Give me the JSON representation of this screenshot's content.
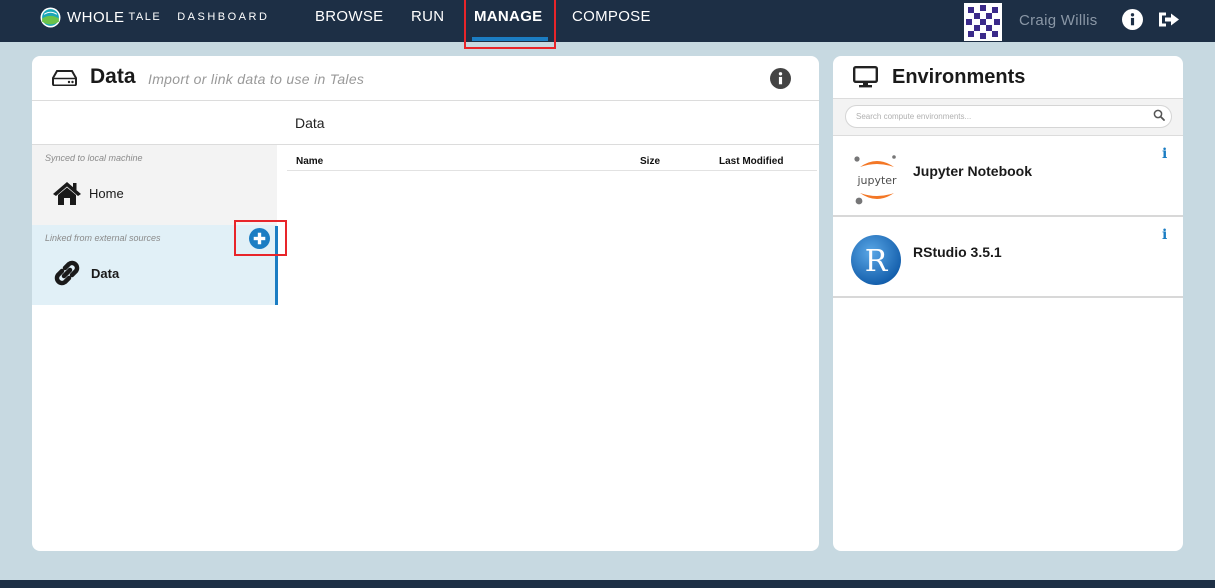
{
  "brand": {
    "name_main": "WHOLE",
    "name_sub": "TALE",
    "section": "DASHBOARD"
  },
  "nav": {
    "browse": "BROWSE",
    "run": "RUN",
    "manage": "MANAGE",
    "compose": "COMPOSE",
    "active": "MANAGE"
  },
  "user": {
    "name": "Craig Willis"
  },
  "data_panel": {
    "title": "Data",
    "subtitle": "Import or link data to use in Tales",
    "breadcrumb": "Data",
    "sidebar": {
      "synced_caption": "Synced to local machine",
      "home_label": "Home",
      "linked_caption": "Linked from external sources",
      "data_label": "Data"
    },
    "table": {
      "columns": [
        "Name",
        "Size",
        "Last Modified"
      ],
      "rows": []
    }
  },
  "env_panel": {
    "title": "Environments",
    "search_placeholder": "Search compute environments...",
    "items": [
      {
        "name": "Jupyter Notebook",
        "logo": "jupyter-logo",
        "info": "i"
      },
      {
        "name": "RStudio 3.5.1",
        "logo": "rstudio-logo",
        "info": "i"
      }
    ]
  },
  "colors": {
    "nav_bg": "#1d2f45",
    "accent": "#1b7dc3",
    "page_bg": "#c7d9e1",
    "highlight_box": "#e8252a"
  }
}
